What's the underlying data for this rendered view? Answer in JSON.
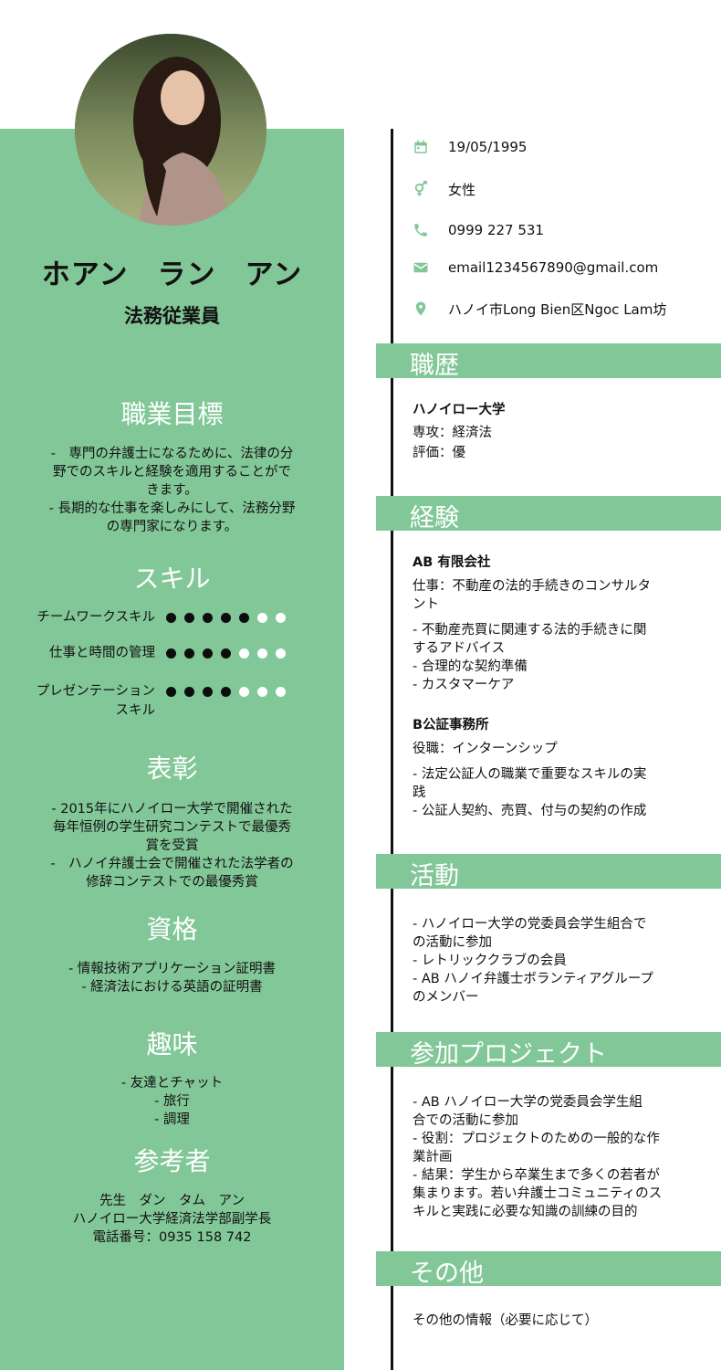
{
  "profile": {
    "name": "ホアン　ラン　アン",
    "job_title": "法務従業員"
  },
  "colors": {
    "accent": "#82c797",
    "heading_text": "#ffffff",
    "text": "#111111"
  },
  "sections_left": {
    "objective": {
      "heading": "職業目標",
      "lines": [
        "-　専門の弁護士になるために、法律の分",
        "野でのスキルと経験を適用することがで",
        "きます。",
        "- 長期的な仕事を楽しみにして、法務分野",
        "の専門家になります。"
      ]
    },
    "skills": {
      "heading": "スキル",
      "items": [
        {
          "name": "チームワークスキル",
          "level": 5,
          "max": 7
        },
        {
          "name": "仕事と時間の管理",
          "level": 4,
          "max": 7
        },
        {
          "name": "プレゼンテーション\nスキル",
          "level": 4,
          "max": 7
        }
      ]
    },
    "awards": {
      "heading": "表彰",
      "lines": [
        "- 2015年にハノイロー大学で開催された",
        "毎年恒例の学生研究コンテストで最優秀",
        "賞を受賞",
        "-　ハノイ弁護士会で開催された法学者の",
        "修辞コンテストでの最優秀賞"
      ]
    },
    "certificates": {
      "heading": "資格",
      "lines": [
        "- 情報技術アプリケーション証明書",
        "- 経済法における英語の証明書"
      ]
    },
    "hobbies": {
      "heading": "趣味",
      "lines": [
        "- 友達とチャット",
        "- 旅行",
        "- 調理"
      ]
    },
    "references": {
      "heading": "参考者",
      "lines": [
        "先生　ダン　タム　アン",
        "ハノイロー大学経済法学部副学長",
        "電話番号：0935 158 742"
      ]
    }
  },
  "contact": {
    "birthday": "19/05/1995",
    "gender": "女性",
    "phone": "0999 227 531",
    "email": "email1234567890@gmail.com",
    "address": "ハノイ市Long Bien区Ngoc Lam坊",
    "icons": [
      "calendar-icon",
      "gender-icon",
      "phone-icon",
      "email-icon",
      "location-pin-icon"
    ]
  },
  "sections_right": {
    "education": {
      "heading": "職歴",
      "school": "ハノイロー大学",
      "major": "専攻：経済法",
      "grade": "評価：優"
    },
    "experience": {
      "heading": "経験",
      "jobs": [
        {
          "company": "AB 有限会社",
          "role_lines": [
            "仕事：不動産の法的手続きのコンサルタ",
            "ント"
          ],
          "detail_lines": [
            "- 不動産売買に関連する法的手続きに関",
            "するアドバイス",
            "- 合理的な契約準備",
            "- カスタマーケア"
          ]
        },
        {
          "company": "B公証事務所",
          "role_lines": [
            "役職：インターンシップ"
          ],
          "detail_lines": [
            "- 法定公証人の職業で重要なスキルの実",
            "践",
            "- 公証人契約、売買、付与の契約の作成"
          ]
        }
      ]
    },
    "activities": {
      "heading": "活動",
      "lines": [
        "- ハノイロー大学の党委員会学生組合で",
        "の活動に参加",
        "- レトリッククラブの会員",
        "- AB ハノイ弁護士ボランティアグループ",
        "のメンバー"
      ]
    },
    "projects": {
      "heading": "参加プロジェクト",
      "lines": [
        "- AB ハノイロー大学の党委員会学生組",
        "合での活動に参加",
        "- 役割：プロジェクトのための一般的な作",
        "業計画",
        "- 結果：学生から卒業生まで多くの若者が",
        "集まります。若い弁護士コミュニティのス",
        "キルと実践に必要な知識の訓練の目的"
      ]
    },
    "other": {
      "heading": "その他",
      "text": "その他の情報（必要に応じて）"
    }
  }
}
